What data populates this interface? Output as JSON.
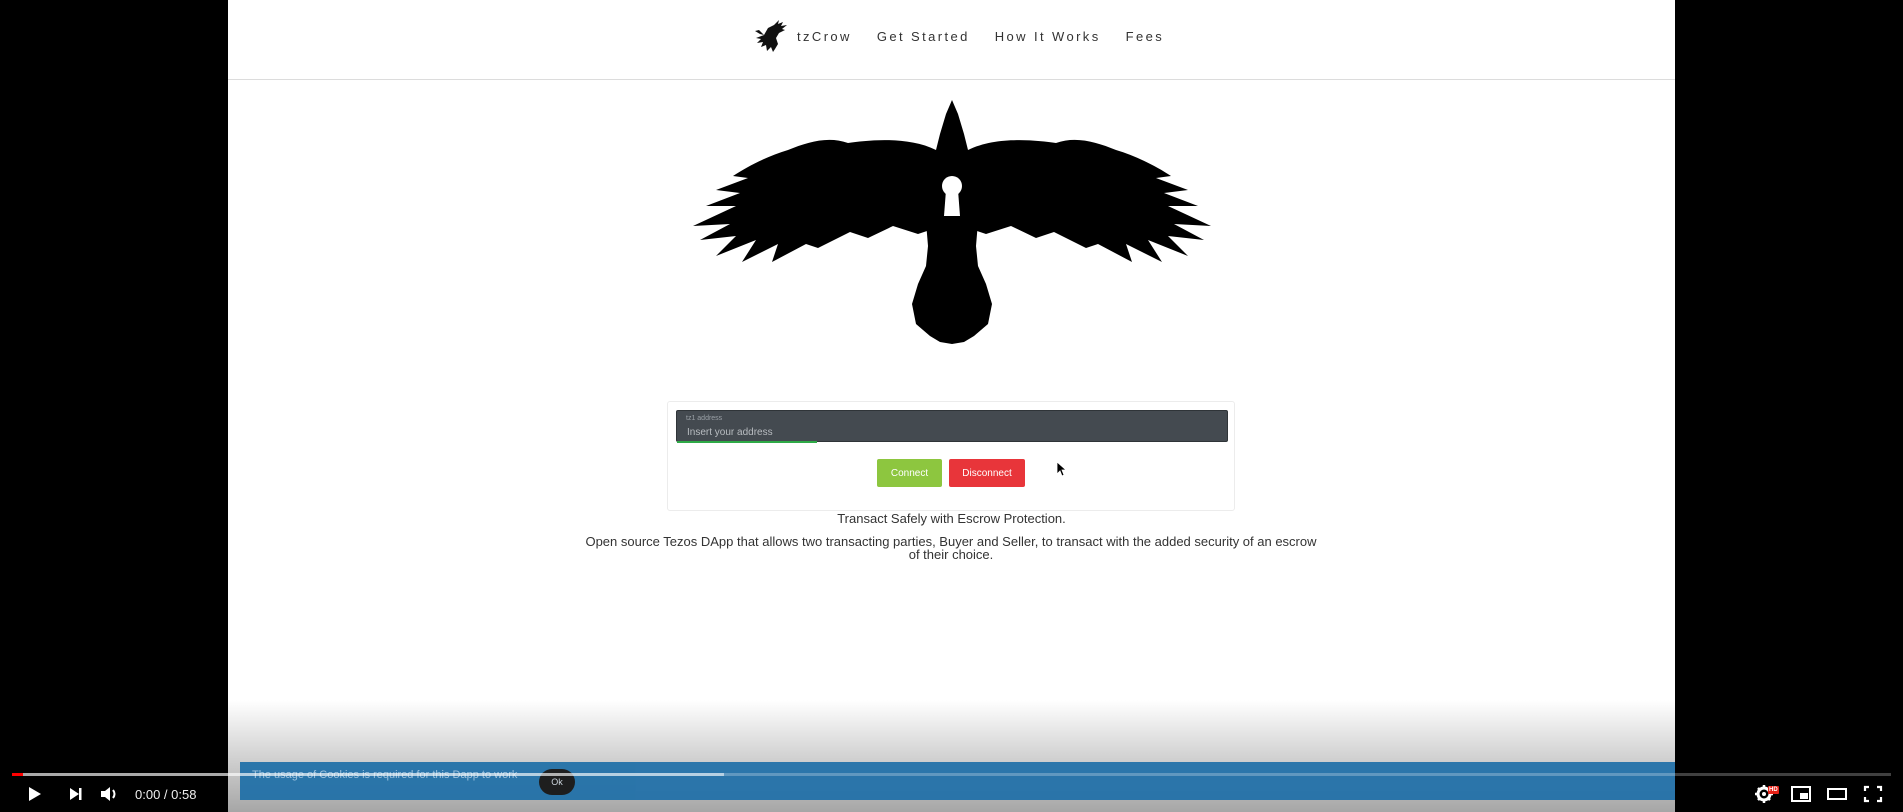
{
  "navbar": {
    "brand": "tzCrow",
    "links": [
      "Get Started",
      "How It Works",
      "Fees"
    ]
  },
  "connect": {
    "field_label": "tz1 address",
    "placeholder": "Insert your address",
    "connect_label": "Connect",
    "disconnect_label": "Disconnect"
  },
  "hero": {
    "tagline": "Transact Safely with Escrow Protection.",
    "description": "Open source Tezos DApp that allows two transacting parties, Buyer and Seller, to transact with the added security of an escrow of their choice."
  },
  "cookie": {
    "message": "The usage of Cookies is required for this Dapp to work",
    "ok_label": "Ok"
  },
  "player": {
    "current_time": "0:00",
    "duration": "0:58",
    "time_text": "0:00 / 0:58",
    "played_fraction": 0.006,
    "buffered_fraction": 0.379,
    "quality_badge": "HD",
    "icons": [
      "play-icon",
      "next-icon",
      "volume-icon",
      "settings-icon",
      "miniplayer-icon",
      "theater-icon",
      "fullscreen-icon"
    ],
    "accent_color": "#ff0000"
  },
  "colors": {
    "connect_button": "#8dc63f",
    "disconnect_button": "#e8353a",
    "cookie_banner": "#1e6fa8",
    "address_field": "#444a50"
  }
}
